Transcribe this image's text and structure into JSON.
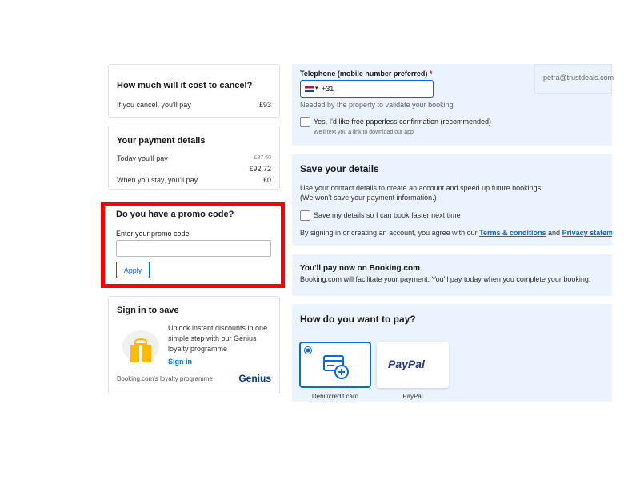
{
  "cancel": {
    "title": "How much will it cost to cancel?",
    "label": "If you cancel, you'll pay",
    "value": "£93"
  },
  "payment": {
    "title": "Your payment details",
    "today_label": "Today you'll pay",
    "today_old": "£97.60",
    "today_value": "£92.72",
    "stay_label": "When you stay, you'll pay",
    "stay_value": "£0"
  },
  "promo": {
    "title": "Do you have a promo code?",
    "label": "Enter your promo code",
    "value": "",
    "apply": "Apply",
    "highlight_color": "#ff0000"
  },
  "signin": {
    "title": "Sign in to save",
    "text": "Unlock instant discounts in one simple step with our Genius loyalty programme",
    "link": "Sign in",
    "footer": "Booking.com's loyalty programme",
    "brand": "Genius"
  },
  "phone": {
    "label": "Telephone (mobile number preferred)",
    "required": "*",
    "value": "+31",
    "hint": "Needed by the property to validate your booking",
    "email": "petra@trustdeals.com",
    "paperless": "Yes, I'd like free paperless confirmation (recommended)",
    "paperless_hint": "We'll text you a link to download our app"
  },
  "save": {
    "title": "Save your details",
    "line1": "Use your contact details to create an account and speed up future bookings.",
    "line2": "(We won't save your payment information.)",
    "checkbox": "Save my details so I can book faster next time",
    "agree_prefix": "By signing in or creating an account, you agree with our",
    "terms": "Terms & conditions",
    "and": "and",
    "privacy": "Privacy statement"
  },
  "paynow": {
    "title": "You'll pay now on Booking.com",
    "text": "Booking.com will facilitate your payment. You'll pay today when you complete your booking."
  },
  "howpay": {
    "title": "How do you want to pay?",
    "options": [
      {
        "label": "Debit/credit card",
        "selected": true
      },
      {
        "label": "PayPal",
        "selected": false
      }
    ],
    "paypal_logo": "PayPal"
  }
}
